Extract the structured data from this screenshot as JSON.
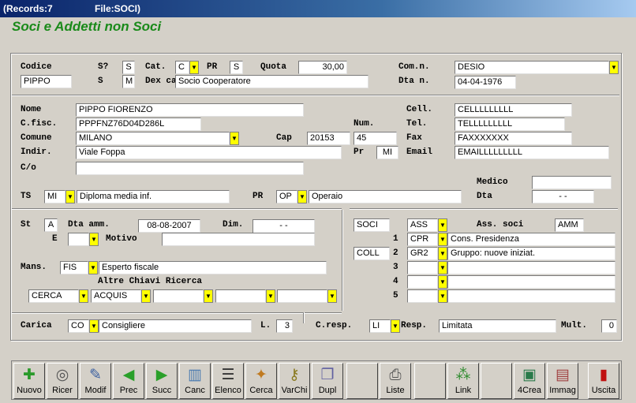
{
  "titlebar": {
    "records": "(Records:7",
    "file": "File:SOCI)"
  },
  "app_title": "Soci e Addetti non Soci",
  "labels": {
    "codice": "Codice",
    "s_q": "S?",
    "cat": "Cat.",
    "pr": "PR",
    "quota": "Quota",
    "comn": "Com.n.",
    "s": "S",
    "dexca": "Dex ca",
    "dtan": "Dta n.",
    "nome": "Nome",
    "cfisc": "C.fisc.",
    "comune": "Comune",
    "cap": "Cap",
    "num": "Num.",
    "indir": "Indir.",
    "pr2": "Pr",
    "co": "C/o",
    "cell": "Cell.",
    "tel": "Tel.",
    "fax": "Fax",
    "email": "Email",
    "medico": "Medico",
    "ts": "TS",
    "pr3": "PR",
    "dta": "Dta",
    "st": "St",
    "dtaamm": "Dta amm.",
    "dim": "Dim.",
    "e": "E",
    "motivo": "Motivo",
    "mans": "Mans.",
    "altre": "Altre Chiavi Ricerca",
    "ass": "Ass. soci",
    "carica": "Carica",
    "l": "L.",
    "cresp": "C.resp.",
    "resp": "Resp.",
    "mult": "Mult."
  },
  "fields": {
    "codice": "PIPPO",
    "s_q": "S",
    "cat": "C",
    "pr": "S",
    "quota": "30,00",
    "comn": "DESIO",
    "s": "M",
    "dexca": "Socio Cooperatore",
    "dtan": "04-04-1976",
    "nome": "PIPPO FIORENZO",
    "cfisc": "PPPFNZ76D04D286L",
    "comune": "MILANO",
    "cap": "20153",
    "num": "45",
    "indir": "Viale Foppa",
    "pr2": "MI",
    "co": "",
    "cell": "CELLLLLLLLL",
    "tel": "TELLLLLLLLL",
    "fax": "FAXXXXXXX",
    "email": "EMAILLLLLLLLL",
    "medico": "",
    "ts": "MI",
    "ts_desc": "Diploma media inf.",
    "pr3": "OP",
    "pr3_desc": "Operaio",
    "dta": "-   -",
    "st": "A",
    "dtaamm": "08-08-2007",
    "dim": "-   -",
    "e": "",
    "motivo": "",
    "mans": "FIS",
    "mans_desc": "Esperto fiscale",
    "chiave1": "CERCA",
    "chiave2": "ACQUIS",
    "chiave3": "",
    "chiave4": "",
    "chiave5": "",
    "carica": "CO",
    "carica_desc": "Consigliere",
    "l": "3",
    "cresp": "LI",
    "resp": "Limitata",
    "mult": "0"
  },
  "right": {
    "soci": "SOCI",
    "ass": "ASS",
    "ass_val": "AMM",
    "coll": "COLL",
    "rows": [
      {
        "n": "1",
        "code": "CPR",
        "desc": "Cons. Presidenza"
      },
      {
        "n": "2",
        "code": "GR2",
        "desc": "Gruppo: nuove iniziat."
      },
      {
        "n": "3",
        "code": "",
        "desc": ""
      },
      {
        "n": "4",
        "code": "",
        "desc": ""
      },
      {
        "n": "5",
        "code": "",
        "desc": ""
      }
    ]
  },
  "toolbar": [
    {
      "name": "nuovo-button",
      "icon": "new-record-icon",
      "label": "Nuovo"
    },
    {
      "name": "ricerca-button",
      "icon": "magnifier-icon",
      "label": "Ricer"
    },
    {
      "name": "modifica-button",
      "icon": "edit-icon",
      "label": "Modif"
    },
    {
      "name": "prec-button",
      "icon": "arrow-left-icon",
      "label": "Prec"
    },
    {
      "name": "succ-button",
      "icon": "arrow-right-icon",
      "label": "Succ"
    },
    {
      "name": "canc-button",
      "icon": "trash-icon",
      "label": "Canc"
    },
    {
      "name": "elenco-button",
      "icon": "list-icon",
      "label": "Elenco"
    },
    {
      "name": "cerca-button",
      "icon": "search-icon",
      "label": "Cerca"
    },
    {
      "name": "varchi-button",
      "icon": "keys-icon",
      "label": "VarChi"
    },
    {
      "name": "dupl-button",
      "icon": "duplicate-icon",
      "label": "Dupl"
    },
    {
      "name": "empty-button-1",
      "icon": "",
      "label": ""
    },
    {
      "name": "liste-button",
      "icon": "printer-icon",
      "label": "Liste"
    },
    {
      "name": "empty-button-2",
      "icon": "",
      "label": ""
    },
    {
      "name": "link-button",
      "icon": "link-icon",
      "label": "Link"
    },
    {
      "name": "empty-button-3",
      "icon": "",
      "label": ""
    },
    {
      "name": "crea-button",
      "icon": "create-icon",
      "label": "4Crea"
    },
    {
      "name": "immag-button",
      "icon": "image-card-icon",
      "label": "Immag"
    },
    {
      "name": "empty-button-4",
      "icon": "",
      "label": ""
    },
    {
      "name": "uscita-button",
      "icon": "exit-door-icon",
      "label": "Uscita"
    }
  ]
}
